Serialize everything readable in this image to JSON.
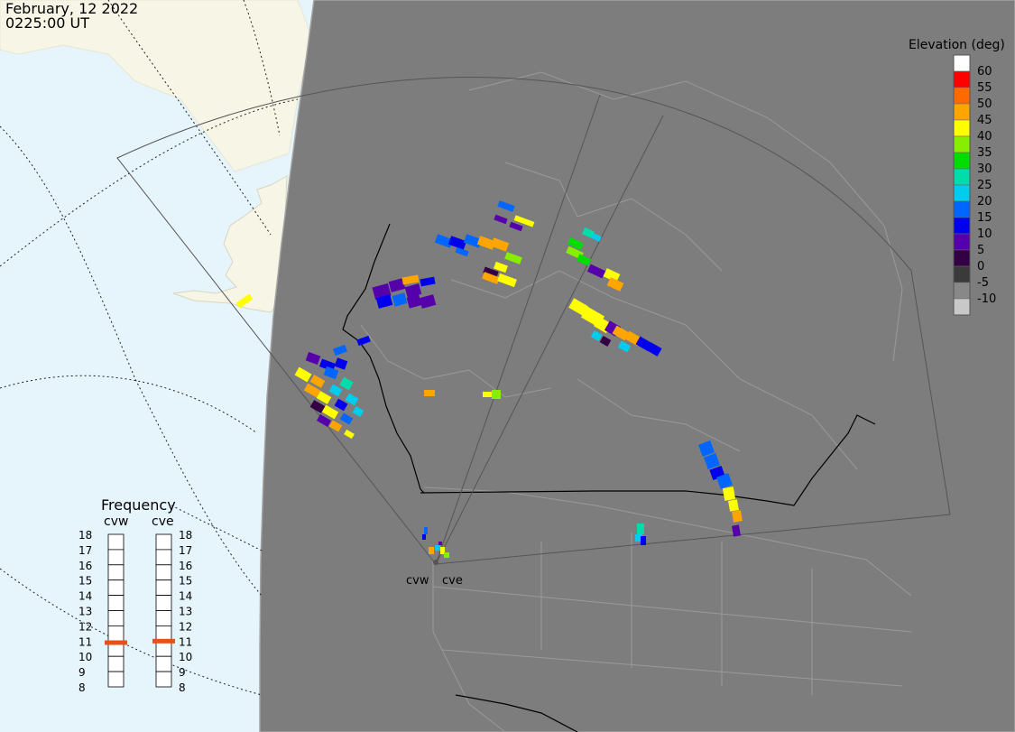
{
  "header": {
    "date": "February, 12 2022",
    "time": "0225:00 UT"
  },
  "colors": {
    "ocean": "#e6f4fc",
    "land": "#f7f5e6",
    "night": "#7d7d7d",
    "night_border": "#a3a3a3",
    "fov": "#555555",
    "border": "#000000"
  },
  "elevation_scale": {
    "title": "Elevation (deg)",
    "items": [
      {
        "label": "60",
        "color": "#ffffff"
      },
      {
        "label": "55",
        "color": "#ff0000"
      },
      {
        "label": "50",
        "color": "#ff6a00"
      },
      {
        "label": "45",
        "color": "#ffa500"
      },
      {
        "label": "40",
        "color": "#ffff00"
      },
      {
        "label": "35",
        "color": "#88ee00"
      },
      {
        "label": "30",
        "color": "#00dd00"
      },
      {
        "label": "25",
        "color": "#00ddaa"
      },
      {
        "label": "20",
        "color": "#00ccee"
      },
      {
        "label": "15",
        "color": "#0066ff"
      },
      {
        "label": "10",
        "color": "#0000ee"
      },
      {
        "label": "5",
        "color": "#5500aa"
      },
      {
        "label": "0",
        "color": "#330044"
      },
      {
        "label": "-5",
        "color": "#3a3a3a"
      },
      {
        "label": "-10",
        "color": "#888888"
      },
      {
        "label": "",
        "color": "#c8c8c8"
      }
    ]
  },
  "frequency": {
    "title": "Frequency",
    "ticks": [
      "18",
      "17",
      "16",
      "15",
      "14",
      "13",
      "12",
      "11",
      "10",
      "9",
      "8"
    ],
    "radars": [
      {
        "name": "cvw",
        "value": 10.9
      },
      {
        "name": "cve",
        "value": 11.0
      }
    ],
    "marker_color": "#e8501a"
  },
  "radar_sites": [
    {
      "name": "cvw"
    },
    {
      "name": "cve"
    }
  ]
}
